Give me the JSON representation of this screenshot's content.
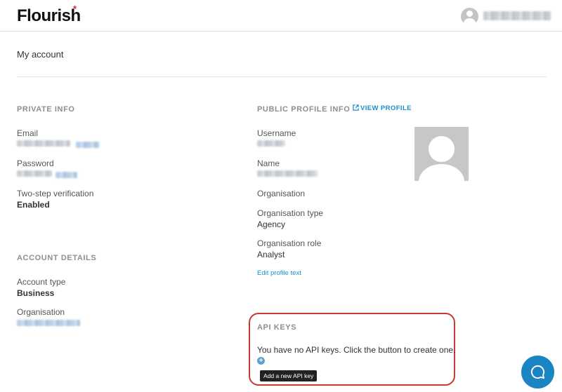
{
  "header": {
    "logo_text": "Flourish",
    "logo_mark": "*",
    "accent_color": "#e3262d",
    "user_avatar_icon": "user-avatar-icon"
  },
  "page": {
    "title": "My account"
  },
  "private_info": {
    "heading": "PRIVATE INFO",
    "email_label": "Email",
    "password_label": "Password",
    "two_step_label": "Two-step verification",
    "two_step_value": "Enabled"
  },
  "account_details": {
    "heading": "ACCOUNT DETAILS",
    "account_type_label": "Account type",
    "account_type_value": "Business",
    "organisation_label": "Organisation"
  },
  "public_profile": {
    "heading": "PUBLIC PROFILE INFO",
    "view_profile_label": "VIEW PROFILE",
    "username_label": "Username",
    "name_label": "Name",
    "organisation_label": "Organisation",
    "organisation_type_label": "Organisation type",
    "organisation_type_value": "Agency",
    "organisation_role_label": "Organisation role",
    "organisation_role_value": "Analyst",
    "edit_profile_label": "Edit profile text"
  },
  "api_keys": {
    "heading": "API KEYS",
    "message": "You have no API keys. Click the button to create one.",
    "add_tooltip": "Add a new API key",
    "highlight_color": "#c23b35"
  },
  "help": {
    "icon": "chat-bubble-icon",
    "color": "#1b84c2"
  }
}
